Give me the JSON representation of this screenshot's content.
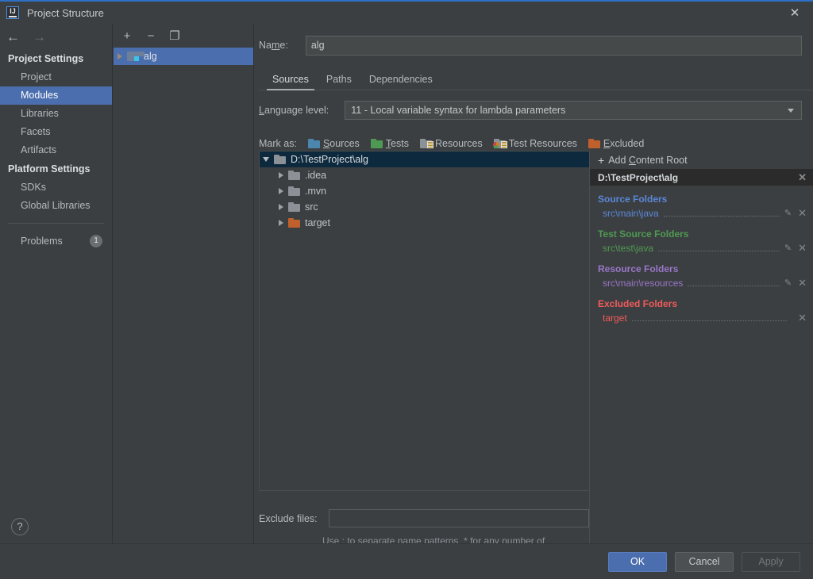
{
  "window": {
    "title": "Project Structure",
    "logo_text": "IJ",
    "close_icon": "✕"
  },
  "sidebar": {
    "nav": {
      "back_icon": "←",
      "forward_icon": "→"
    },
    "groups": [
      {
        "title": "Project Settings",
        "items": [
          {
            "label": "Project",
            "selected": false
          },
          {
            "label": "Modules",
            "selected": true
          },
          {
            "label": "Libraries",
            "selected": false
          },
          {
            "label": "Facets",
            "selected": false
          },
          {
            "label": "Artifacts",
            "selected": false
          }
        ]
      },
      {
        "title": "Platform Settings",
        "items": [
          {
            "label": "SDKs",
            "selected": false
          },
          {
            "label": "Global Libraries",
            "selected": false
          }
        ]
      }
    ],
    "problems": {
      "label": "Problems",
      "count": "1"
    },
    "help_icon": "?"
  },
  "modules_panel": {
    "toolbar": {
      "add": "+",
      "remove": "−",
      "copy": "❐"
    },
    "modules": [
      {
        "name": "alg",
        "expander": "▶"
      }
    ]
  },
  "main": {
    "name_label": "Name:",
    "name_value": "alg",
    "tabs": [
      {
        "label": "Sources",
        "active": true
      },
      {
        "label": "Paths",
        "active": false
      },
      {
        "label": "Dependencies",
        "active": false
      }
    ],
    "language_level_label": "Language level:",
    "language_level_value": "11 - Local variable syntax for lambda parameters",
    "mark_as_label": "Mark as:",
    "mark_as": [
      {
        "label": "Sources",
        "icon": "folder-blue"
      },
      {
        "label": "Tests",
        "icon": "folder-green"
      },
      {
        "label": "Resources",
        "icon": "folder-grey-lines"
      },
      {
        "label": "Test Resources",
        "icon": "folder-green-lines"
      },
      {
        "label": "Excluded",
        "icon": "folder-orange"
      }
    ],
    "tree": [
      {
        "label": "D:\\TestProject\\alg",
        "depth": 0,
        "expander": "▼",
        "icon": "folder-grey",
        "selected": true
      },
      {
        "label": ".idea",
        "depth": 1,
        "expander": "▶",
        "icon": "folder-grey",
        "selected": false
      },
      {
        "label": ".mvn",
        "depth": 1,
        "expander": "▶",
        "icon": "folder-grey",
        "selected": false
      },
      {
        "label": "src",
        "depth": 1,
        "expander": "▶",
        "icon": "folder-grey",
        "selected": false
      },
      {
        "label": "target",
        "depth": 1,
        "expander": "▶",
        "icon": "folder-orange",
        "selected": false
      }
    ],
    "exclude_files_label": "Exclude files:",
    "exclude_files_value": "",
    "exclude_files_hint": "Use ; to separate name patterns, * for any number of symbols, ? for one."
  },
  "content_roots": {
    "add_label": "Add Content Root",
    "add_icon": "+",
    "root_path": "D:\\TestProject\\alg",
    "close_icon": "✕",
    "sections": [
      {
        "title": "Source Folders",
        "color": "#5b87d8",
        "entries": [
          {
            "path": "src\\main\\java",
            "edit_icon": "✎",
            "remove_icon": "✕"
          }
        ]
      },
      {
        "title": "Test Source Folders",
        "color": "#4f9a52",
        "entries": [
          {
            "path": "src\\test\\java",
            "edit_icon": "✎",
            "remove_icon": "✕"
          }
        ]
      },
      {
        "title": "Resource Folders",
        "color": "#9876c8",
        "entries": [
          {
            "path": "src\\main\\resources",
            "edit_icon": "✎",
            "remove_icon": "✕"
          }
        ]
      },
      {
        "title": "Excluded Folders",
        "color": "#f05b5b",
        "entries": [
          {
            "path": "target",
            "edit_icon": "",
            "remove_icon": "✕"
          }
        ]
      }
    ]
  },
  "footer": {
    "ok": "OK",
    "cancel": "Cancel",
    "apply": "Apply"
  },
  "colors": {
    "accent_blue": "#4b6eaf",
    "window_bg": "#3c3f41",
    "selection_navy": "#0d293e",
    "source_blue": "#5b87d8",
    "test_green": "#4f9a52",
    "resource_purple": "#9876c8",
    "excluded_red": "#f05b5b"
  }
}
